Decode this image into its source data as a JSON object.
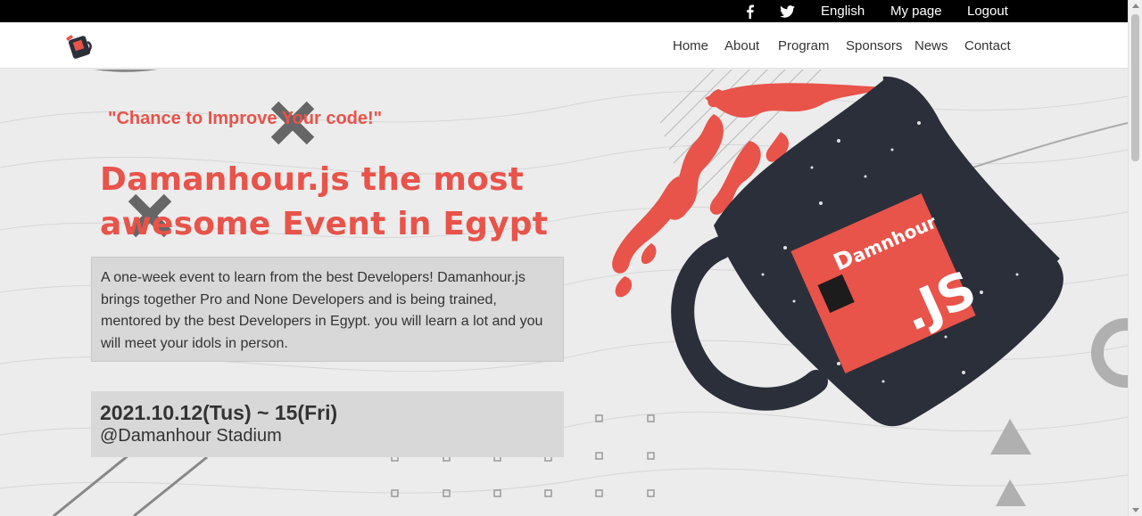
{
  "topbar": {
    "facebook_icon": "facebook-icon",
    "twitter_icon": "twitter-icon",
    "language": "English",
    "mypage": "My page",
    "logout": "Logout"
  },
  "nav": {
    "items": [
      "Home",
      "About",
      "Program",
      "Sponsors",
      "News",
      "Contact"
    ]
  },
  "hero": {
    "tagline": "\"Chance to Improve Your code!\"",
    "headline_line1": "Damanhour.js the most",
    "headline_line2": "awesome Event in Egypt",
    "description": "A one-week event to learn from the best Developers! Damanhour.js brings together Pro and None Developers and is being trained, mentored by the best Developers in Egypt. you will learn a lot and you will meet your idols in person.",
    "date": "2021.10.12(Tus) ~ 15(Fri)",
    "venue": "@Damanhour Stadium"
  },
  "mug": {
    "logo_initial": "D",
    "logo_word": "amnhour",
    "logo_js": ".JS"
  },
  "colors": {
    "accent": "#e8534a",
    "topbar": "#000000",
    "box": "#d8d8d8",
    "mug": "#2b2f3a"
  }
}
